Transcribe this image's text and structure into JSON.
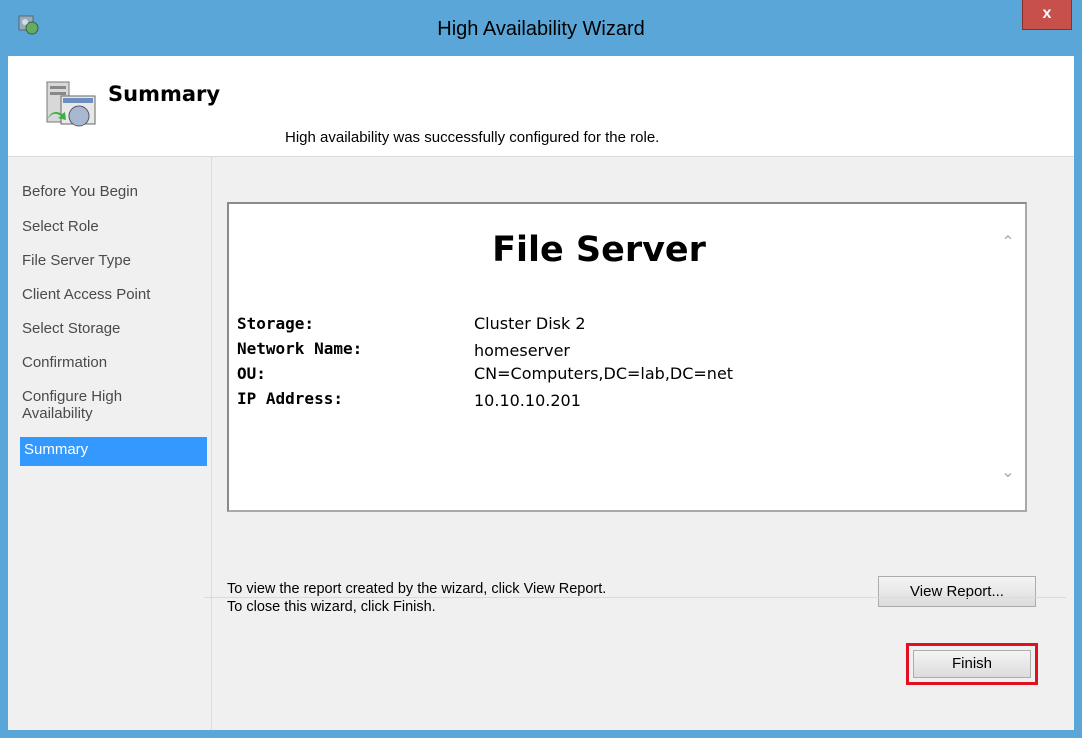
{
  "window": {
    "title": "High Availability Wizard",
    "close_label": "x"
  },
  "header": {
    "title": "Summary"
  },
  "nav": {
    "items": [
      {
        "label": "Before You Begin"
      },
      {
        "label": "Select Role"
      },
      {
        "label": "File Server Type"
      },
      {
        "label": "Client Access Point"
      },
      {
        "label": "Select Storage"
      },
      {
        "label": "Confirmation"
      },
      {
        "label": "Configure High Availability"
      },
      {
        "label": "Summary"
      }
    ],
    "active_index": 7
  },
  "main": {
    "message": "High availability was successfully configured for the role.",
    "report": {
      "heading": "File Server",
      "rows": [
        {
          "key": "Storage:",
          "value": "Cluster Disk 2"
        },
        {
          "key": "Network Name:",
          "value": "homeserver"
        },
        {
          "key": "OU:",
          "value": "CN=Computers,DC=lab,DC=net"
        },
        {
          "key": "IP Address:",
          "value": "10.10.10.201"
        }
      ]
    },
    "hint_line1": "To view the report created by the wizard, click View Report.",
    "hint_line2": "To close this wizard, click Finish.",
    "view_report_label": "View Report...",
    "finish_label": "Finish"
  },
  "colors": {
    "accent": "#3399ff",
    "frame": "#5aa6d8",
    "close": "#c7504a",
    "highlight": "#e01020"
  }
}
